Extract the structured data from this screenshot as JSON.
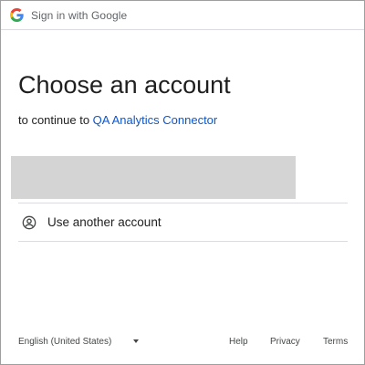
{
  "topbar": {
    "icon": "google-g-icon",
    "title": "Sign in with Google"
  },
  "main": {
    "heading": "Choose an account",
    "subtitle_prefix": "to continue to ",
    "app_name": "QA Analytics Connector",
    "account_entry": {
      "redacted": true,
      "placeholder_color": "#d4d4d4"
    },
    "use_another_account": {
      "icon": "person-circle-icon",
      "label": "Use another account"
    }
  },
  "footer": {
    "language": {
      "selected": "English (United States)",
      "icon": "caret-down-icon"
    },
    "links": {
      "help": "Help",
      "privacy": "Privacy",
      "terms": "Terms"
    }
  },
  "colors": {
    "link": "#0b57d0",
    "text": "#1f1f1f",
    "muted": "#5f6368",
    "divider": "#dadce0",
    "google_blue": "#4285f4",
    "google_red": "#ea4335",
    "google_yellow": "#fbbc05",
    "google_green": "#34a853"
  }
}
